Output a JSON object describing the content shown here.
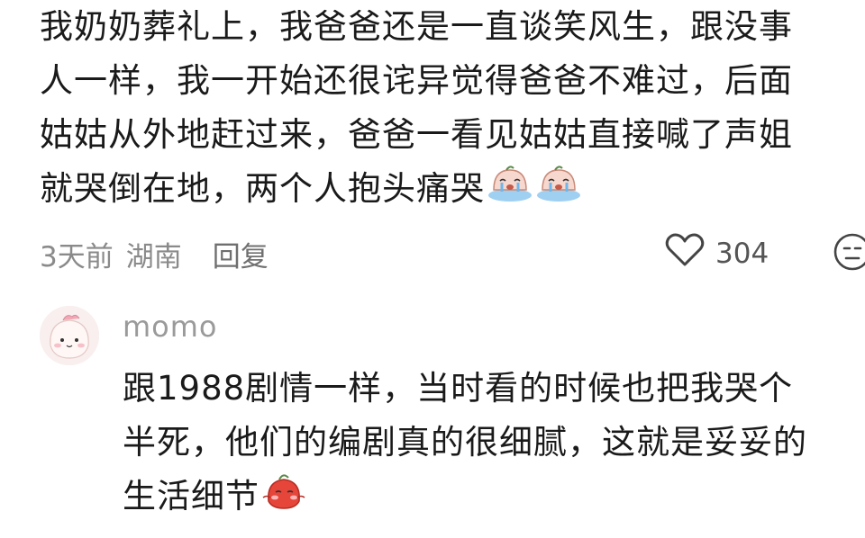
{
  "comment": {
    "lines": [
      "我奶奶葬礼上，我爸爸还是一直谈笑风生，跟没事",
      "人一样，我一开始还很诧异觉得爸爸不难过，后面",
      "姑姑从外地赶过来，爸爸一看见姑姑直接喊了声姐",
      "就哭倒在地，两个人抱头痛哭"
    ],
    "emoji_icons": [
      "crying-emoji-icon",
      "crying-emoji-icon"
    ],
    "time": "3天前",
    "location": "湖南",
    "reply_label": "回复",
    "like_count": "304"
  },
  "reply": {
    "username": "momo",
    "avatar_icon": "avatar-face-icon",
    "lines": [
      "跟1988剧情一样，当时看的时候也把我哭个",
      "半死，他们的编剧真的很细腻，这就是妥妥的",
      "生活细节"
    ],
    "emoji_icon": "blushing-emoji-icon"
  },
  "colors": {
    "text": "#1a1a1a",
    "meta": "#8a8a8a",
    "username": "#9a9a9a"
  }
}
